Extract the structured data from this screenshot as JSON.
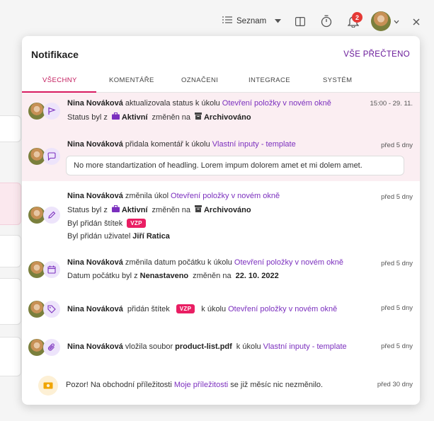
{
  "topbar": {
    "view_label": "Seznam",
    "notifications_count": "2",
    "icons": [
      "list-icon",
      "caret-down-icon",
      "columns-icon",
      "timer-icon",
      "bell-icon",
      "chevron-down-icon",
      "close-icon"
    ]
  },
  "panel": {
    "title": "Notifikace",
    "mark_all_read": "VŠE PŘEČTENO",
    "tabs": [
      "VŠECHNY",
      "KOMENTÁŘE",
      "OZNAČENI",
      "INTEGRACE",
      "SYSTÉM"
    ],
    "active_tab": "VŠECHNY"
  },
  "notifications": [
    {
      "icon": "flag-icon",
      "user": "Nina Nováková",
      "action": "aktualizovala status k úkolu",
      "task": "Otevření položky v novém okně",
      "time": "15:00 - 29. 11.",
      "detail_prefix": "Status byl z",
      "from_status": "Aktivní",
      "changed_to": "změněn na",
      "to_status": "Archivováno"
    },
    {
      "icon": "comment-icon",
      "user": "Nina Nováková",
      "action": "přidala komentář k úkolu",
      "task": "Vlastní inputy - template",
      "time": "před 5 dny",
      "comment": "No more standartization of headling. Lorem impum dolorem amet et mi dolem amet."
    },
    {
      "icon": "pencil-icon",
      "user": "Nina Nováková",
      "action": "změnila úkol",
      "task": "Otevření položky v novém okně",
      "time": "před 5 dny",
      "detail_prefix": "Status byl z",
      "from_status": "Aktivní",
      "changed_to": "změněn na",
      "to_status": "Archivováno",
      "tag_line": "Byl přidán štítek",
      "tag": "VZP",
      "user_line": "Byl přidán uživatel",
      "added_user": "Jiří Ratica"
    },
    {
      "icon": "calendar-icon",
      "user": "Nina Nováková",
      "action": "změnila datum počátku k úkolu",
      "task": "Otevření položky v novém okně",
      "time": "před 5 dny",
      "detail_prefix": "Datum počátku byl z",
      "from_value": "Nenastaveno",
      "changed_to": "změněn na",
      "to_value": "22. 10. 2022"
    },
    {
      "icon": "tag-icon",
      "user": "Nina Nováková",
      "action": "přidán štítek",
      "tag": "VZP",
      "action2": "k úkolu",
      "task": "Otevření položky v novém okně",
      "time": "před 5 dny"
    },
    {
      "icon": "paperclip-icon",
      "user": "Nina Nováková",
      "action": "vložila soubor",
      "file": "product-list.pdf",
      "action2": "k úkolu",
      "task": "Vlastní inputy - template",
      "time": "před 5 dny"
    },
    {
      "icon": "money-icon",
      "text_before": "Pozor! Na obchodní příležitosti",
      "link": "Moje příležitosti",
      "text_after": "se již měsíc nic nezměnilo.",
      "time": "před 30 dny"
    }
  ]
}
